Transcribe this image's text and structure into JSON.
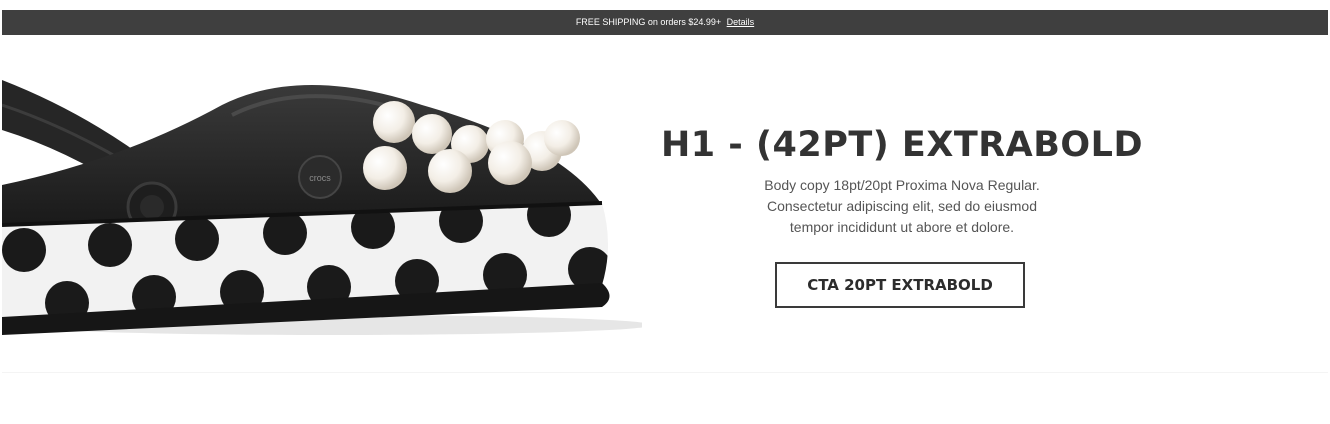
{
  "promo_bar": {
    "text": "FREE SHIPPING on orders $24.99+",
    "link_label": "Details"
  },
  "hero": {
    "title": "H1 - (42PT) EXTRABOLD",
    "body_line_1": "Body copy 18pt/20pt Proxima Nova Regular.",
    "body_line_2": "Consectetur adipiscing elit, sed do eiusmod",
    "body_line_3": "tempor incididunt ut abore et dolore.",
    "cta_label": "CTA 20PT EXTRABOLD",
    "image_logo_text": "crocs"
  },
  "colors": {
    "promo_background": "#3f3f3f",
    "shoe_black": "#1c1c1c",
    "polka_white": "#f2f2f2",
    "pearl": "#f3eee6",
    "text_dark": "#333333"
  }
}
